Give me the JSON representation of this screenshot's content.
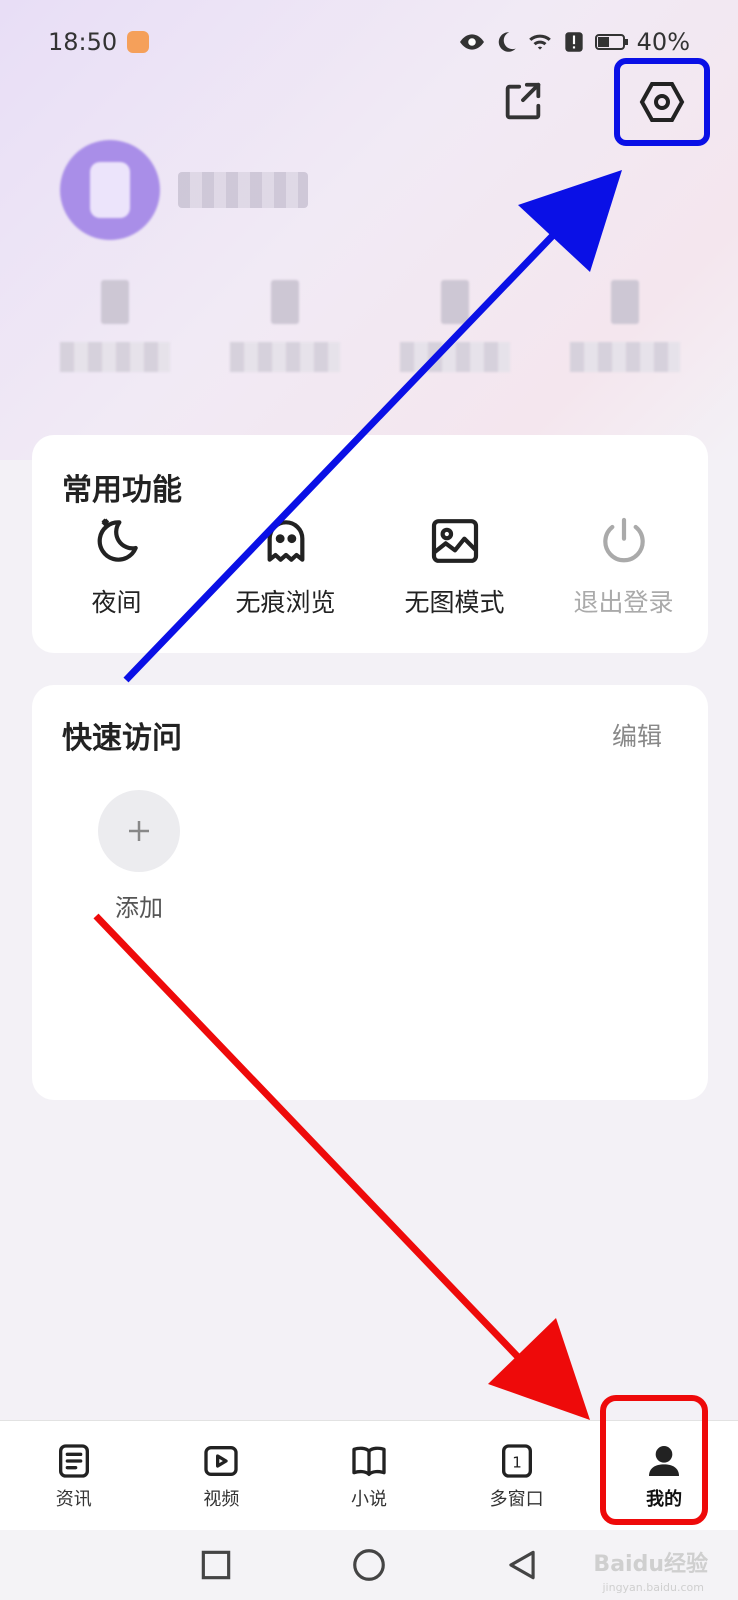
{
  "status_bar": {
    "time": "18:50",
    "battery": "40%"
  },
  "header": {
    "share_icon": "share-icon",
    "settings_icon": "settings-hexagon-icon"
  },
  "common": {
    "title": "常用功能",
    "items": [
      {
        "label": "夜间",
        "icon": "moon-icon"
      },
      {
        "label": "无痕浏览",
        "icon": "ghost-icon"
      },
      {
        "label": "无图模式",
        "icon": "image-icon"
      },
      {
        "label": "退出登录",
        "icon": "power-icon"
      }
    ]
  },
  "quick": {
    "title": "快速访问",
    "edit": "编辑",
    "add_label": "添加"
  },
  "nav": [
    {
      "label": "资讯",
      "icon": "news-icon"
    },
    {
      "label": "视频",
      "icon": "video-icon"
    },
    {
      "label": "小说",
      "icon": "book-icon"
    },
    {
      "label": "多窗口",
      "icon": "windows-icon",
      "count": "1"
    },
    {
      "label": "我的",
      "icon": "profile-icon"
    }
  ],
  "watermark": {
    "text": "Baidu经验",
    "sub": "jingyan.baidu.com"
  },
  "colors": {
    "annotation_blue": "#0a10e6",
    "annotation_red": "#ee0a0a"
  }
}
